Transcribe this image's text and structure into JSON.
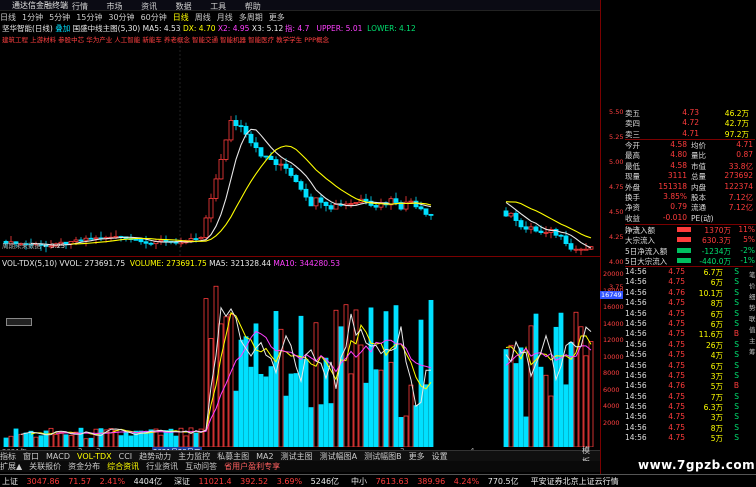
{
  "title_bar": {
    "app_name": "通达信金融终端",
    "menu": [
      "行情",
      "市场",
      "资讯",
      "数据",
      "工具",
      "帮助"
    ],
    "brand": "交易",
    "win_buttons": [
      "-",
      "□",
      "×"
    ]
  },
  "period_bar": {
    "items": [
      "日线",
      "1分钟",
      "5分钟",
      "15分钟",
      "30分钟",
      "60分钟",
      "日线",
      "周线",
      "月线",
      "多周期",
      "更多"
    ],
    "active_index": 6
  },
  "main_info": {
    "line1": "坚华智能(日线)",
    "line1b": "叠加",
    "line1c": "国盛中线主图(5,30)",
    "ma": "MA5: 4.53",
    "dx": "DX: 4.70",
    "x2": "X2: 4.95",
    "x3": "X3: 5.12",
    "ind_label": "指: 4.7",
    "upper": "UPPER: 5.01",
    "lower": "LOWER: 4.12",
    "concepts": "建筑工程 上游材料 参股中芯 华为产业 人工智能 新能车 养老概念 智能交通 智能机器 智能医疗 教学学生 PPP概念",
    "hint": "周期未来数据",
    "hint_val": "← 3.25"
  },
  "vol_info": {
    "label": "VOL-TDX(5,10)",
    "vvol": "VVOL: 273691.75",
    "volume": "VOLUME: 273691.75",
    "ma5": "MA5: 321328.44",
    "ma10": "MA10: 344280.53"
  },
  "vol_axis": [
    "20000",
    "18000",
    "16000",
    "14000",
    "12000",
    "10000",
    "8000",
    "6000",
    "4000",
    "2000"
  ],
  "price_axis": [
    "5.50",
    "5.25",
    "5.00",
    "4.75",
    "4.50",
    "4.25",
    "4.00",
    "3.75"
  ],
  "vol_marker": "16749",
  "date_axis": [
    "2021年",
    "2",
    "3",
    "2021月20日二",
    "3",
    "4"
  ],
  "quote": {
    "asks": [
      {
        "label": "卖五",
        "price": "4.73",
        "vol": "46.2万"
      },
      {
        "label": "卖四",
        "price": "4.72",
        "vol": "42.7万"
      },
      {
        "label": "卖三",
        "price": "4.71",
        "vol": "97.2万"
      }
    ],
    "rows": [
      {
        "l1": "今开",
        "v1": "4.58",
        "l2": "均价",
        "v2": "4.71"
      },
      {
        "l1": "最高",
        "v1": "4.80",
        "l2": "量比",
        "v2": "0.87"
      },
      {
        "l1": "最低",
        "v1": "4.58",
        "l2": "市值",
        "v2": "33.8亿"
      },
      {
        "l1": "现量",
        "v1": "3111",
        "l2": "总量",
        "v2": "273692"
      },
      {
        "l1": "外盘",
        "v1": "151318",
        "l2": "内盘",
        "v2": "122374"
      },
      {
        "l1": "换手",
        "v1": "3.85%",
        "l2": "股本",
        "v2": "7.12亿"
      },
      {
        "l1": "净资",
        "v1": "0.79",
        "l2": "流通",
        "v2": "7.12亿"
      },
      {
        "l1": "收益(一)",
        "v1": "-0.010",
        "l2": "PE(动)",
        "v2": ""
      }
    ],
    "flows": [
      {
        "label": "净流入额",
        "value": "1370万",
        "pct": "11%",
        "up": true
      },
      {
        "label": "大宗流入",
        "value": "630.3万",
        "pct": "5%",
        "up": true
      },
      {
        "label": "5日净流入额",
        "value": "-1234万",
        "pct": "-2%",
        "up": false
      },
      {
        "label": "5日大宗流入",
        "value": "-440.0万",
        "pct": "-1%",
        "up": false
      }
    ],
    "ticks": [
      {
        "time": "14:56",
        "price": "4.75",
        "vol": "6.7万",
        "side": "S"
      },
      {
        "time": "14:56",
        "price": "4.75",
        "vol": "6万",
        "side": "S"
      },
      {
        "time": "14:56",
        "price": "4.76",
        "vol": "10.1万",
        "side": "S"
      },
      {
        "time": "14:56",
        "price": "4.75",
        "vol": "8万",
        "side": "S"
      },
      {
        "time": "14:56",
        "price": "4.75",
        "vol": "6万",
        "side": "S"
      },
      {
        "time": "14:56",
        "price": "4.75",
        "vol": "6万",
        "side": "S"
      },
      {
        "time": "14:56",
        "price": "4.75",
        "vol": "11.6万",
        "side": "B"
      },
      {
        "time": "14:56",
        "price": "4.75",
        "vol": "26万",
        "side": "S"
      },
      {
        "time": "14:56",
        "price": "4.75",
        "vol": "4万",
        "side": "S"
      },
      {
        "time": "14:56",
        "price": "4.75",
        "vol": "6万",
        "side": "S"
      },
      {
        "time": "14:56",
        "price": "4.75",
        "vol": "3万",
        "side": "S"
      },
      {
        "time": "14:56",
        "price": "4.76",
        "vol": "5万",
        "side": "B"
      },
      {
        "time": "14:56",
        "price": "4.75",
        "vol": "7万",
        "side": "S"
      },
      {
        "time": "14:56",
        "price": "4.75",
        "vol": "6.3万",
        "side": "S"
      },
      {
        "time": "14:56",
        "price": "4.75",
        "vol": "3万",
        "side": "S"
      },
      {
        "time": "14:56",
        "price": "4.75",
        "vol": "8万",
        "side": "S"
      },
      {
        "time": "14:56",
        "price": "4.75",
        "vol": "5万",
        "side": "S"
      }
    ],
    "side_tabs": [
      "笔",
      "价",
      "细",
      "势",
      "联",
      "值",
      "主",
      "筹"
    ]
  },
  "tabs_row1": [
    "指标",
    "窗口",
    "MACD",
    "VOL-TDX",
    "CCI",
    "趋势动力",
    "主力监控",
    "私募主图",
    "MA2",
    "测试主图",
    "测试幅图A",
    "测试幅图B",
    "更多",
    "设置"
  ],
  "tabs_row2": [
    "扩展▲",
    "关联报价",
    "资金分布",
    "综合资讯",
    "行业资讯",
    "互动问答",
    "省用户盈利专享"
  ],
  "tabs_right": [
    "模板",
    "+"
  ],
  "status": {
    "items": [
      {
        "name": "上证",
        "value": "3047.86",
        "chg": "71.57",
        "pct": "2.41%",
        "amt": "4404亿"
      },
      {
        "name": "深证",
        "value": "11021.4",
        "chg": "392.52",
        "pct": "3.69%",
        "amt": "5246亿"
      },
      {
        "name": "中小",
        "value": "7613.63",
        "chg": "389.96",
        "pct": "4.24%",
        "amt": "770.5亿"
      }
    ],
    "server": "平安证券北京上证云行情"
  },
  "watermark": "www.7gpzb.com",
  "colors": {
    "up": "#ff3c3c",
    "down": "#00e0ff",
    "ma_yellow": "#ffff00",
    "ma_white": "#e8e8e8",
    "ma_magenta": "#ff40ff"
  }
}
